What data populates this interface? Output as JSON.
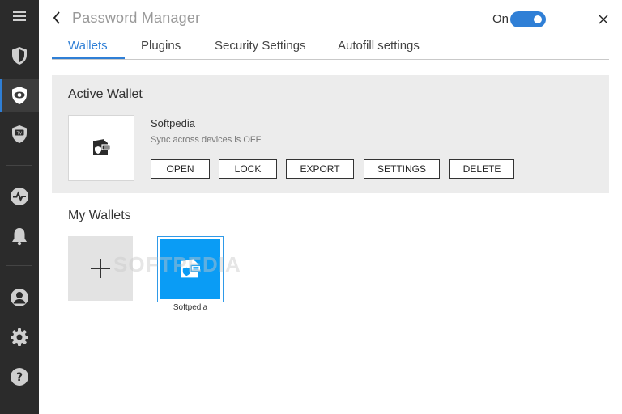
{
  "app": {
    "title": "Password Manager",
    "toggle_label": "On",
    "toggle_state": "on",
    "accent_color": "#2f7fd6"
  },
  "sidebar": {
    "items": [
      {
        "icon": "menu-icon"
      },
      {
        "icon": "shield-icon"
      },
      {
        "icon": "eye-shield-icon",
        "active": true
      },
      {
        "icon": "tv-shield-icon"
      },
      {
        "icon": "activity-icon"
      },
      {
        "icon": "bell-icon"
      },
      {
        "icon": "user-icon"
      },
      {
        "icon": "gear-icon"
      },
      {
        "icon": "help-icon"
      }
    ]
  },
  "tabs": [
    {
      "label": "Wallets",
      "active": true
    },
    {
      "label": "Plugins"
    },
    {
      "label": "Security Settings"
    },
    {
      "label": "Autofill settings"
    }
  ],
  "active_wallet": {
    "heading": "Active Wallet",
    "name": "Softpedia",
    "sync_status": "Sync across devices is OFF",
    "icon": "wallet-icon",
    "buttons": [
      "OPEN",
      "LOCK",
      "EXPORT",
      "SETTINGS",
      "DELETE"
    ]
  },
  "my_wallets": {
    "heading": "My Wallets",
    "add_icon": "plus-icon",
    "wallets": [
      {
        "name": "Softpedia",
        "icon": "wallet-icon",
        "color": "#0a9cf5"
      }
    ]
  },
  "watermark": "SOFTPEDIA"
}
